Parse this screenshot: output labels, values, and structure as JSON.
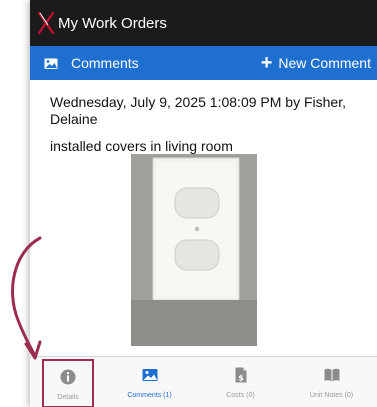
{
  "header": {
    "title": "My Work Orders"
  },
  "section_bar": {
    "label": "Comments",
    "new_comment_label": "New Comment",
    "color": "#1f6fd1"
  },
  "comment": {
    "header": "Wednesday, July 9, 2025 1:08:09 PM by Fisher, Delaine",
    "body": "installed covers in living room"
  },
  "tabs": [
    {
      "label": "Details",
      "icon": "info-icon"
    },
    {
      "label": "Comments (1)",
      "icon": "image-icon",
      "active": true
    },
    {
      "label": "Costs (0)",
      "icon": "dollar-document-icon"
    },
    {
      "label": "Unit Notes (0)",
      "icon": "book-icon"
    }
  ],
  "annotation": {
    "color": "#9b2d4e"
  }
}
